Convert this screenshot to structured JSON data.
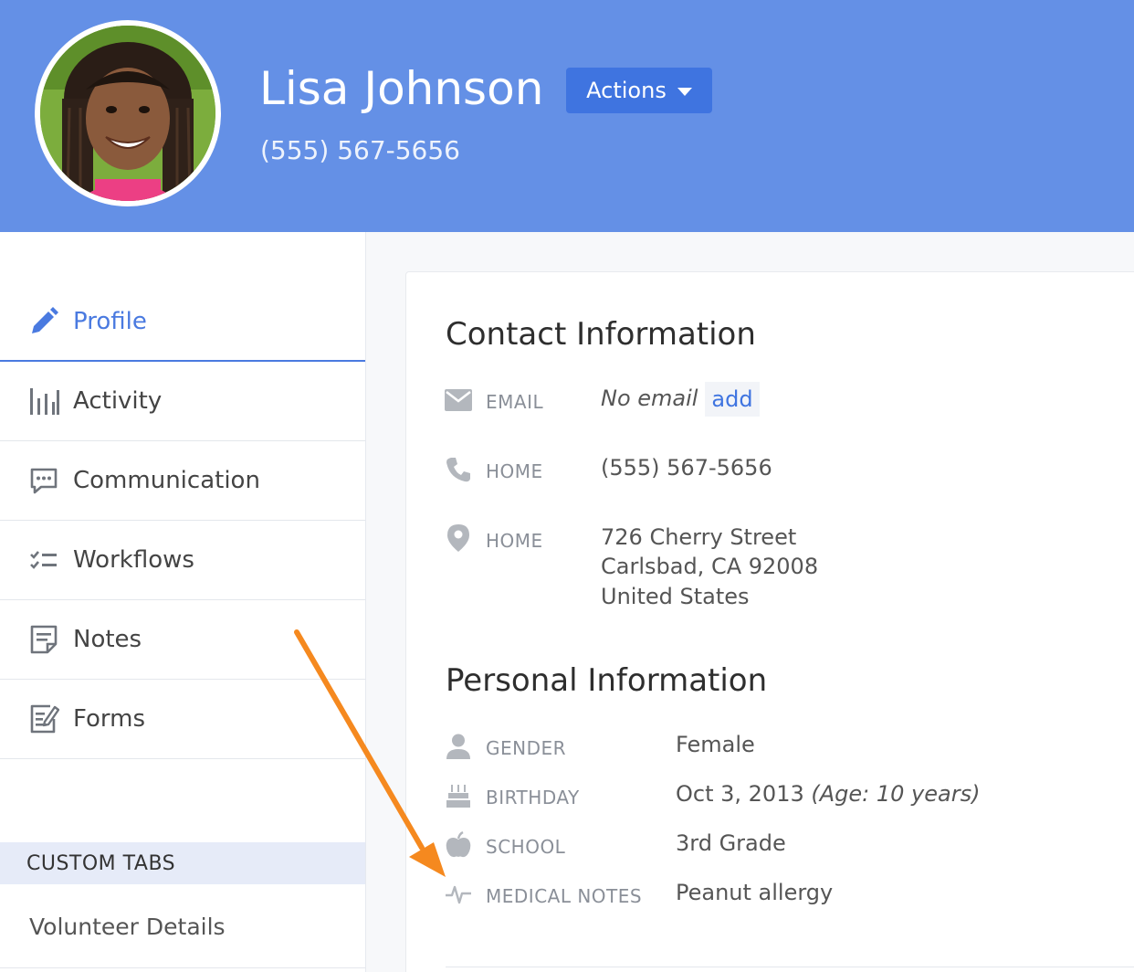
{
  "header": {
    "name": "Lisa Johnson",
    "phone": "(555) 567-5656",
    "actions_label": "Actions",
    "background_color": "#6490e6",
    "button_color": "#3f74e0"
  },
  "sidebar": {
    "items": [
      {
        "label": "Profile",
        "icon": "pencil-icon",
        "active": true
      },
      {
        "label": "Activity",
        "icon": "activity-bars-icon"
      },
      {
        "label": "Communication",
        "icon": "chat-bubble-icon"
      },
      {
        "label": "Workflows",
        "icon": "checklist-icon"
      },
      {
        "label": "Notes",
        "icon": "note-icon"
      },
      {
        "label": "Forms",
        "icon": "form-edit-icon"
      }
    ],
    "custom_tabs_heading": "CUSTOM TABS",
    "custom_tabs": [
      {
        "label": "Volunteer Details"
      }
    ],
    "active_color": "#4a7ae0"
  },
  "contact": {
    "title": "Contact Information",
    "email": {
      "label": "EMAIL",
      "value": "No email",
      "add_label": "add",
      "icon": "envelope-icon"
    },
    "home_phone": {
      "label": "HOME",
      "value": "(555) 567-5656",
      "icon": "phone-icon"
    },
    "home_address": {
      "label": "HOME",
      "icon": "map-pin-icon",
      "line1": "726 Cherry Street",
      "line2": "Carlsbad, CA 92008",
      "line3": "United States"
    }
  },
  "personal": {
    "title": "Personal Information",
    "gender": {
      "label": "GENDER",
      "value": "Female",
      "icon": "person-icon"
    },
    "birthday": {
      "label": "BIRTHDAY",
      "value": "Oct 3, 2013",
      "age": "(Age: 10 years)",
      "icon": "cake-icon"
    },
    "school": {
      "label": "SCHOOL",
      "value": "3rd Grade",
      "icon": "apple-icon"
    },
    "medical_notes": {
      "label": "MEDICAL NOTES",
      "value": "Peanut allergy",
      "icon": "pulse-icon"
    }
  },
  "annotation": {
    "arrow_color": "#f5891f"
  }
}
